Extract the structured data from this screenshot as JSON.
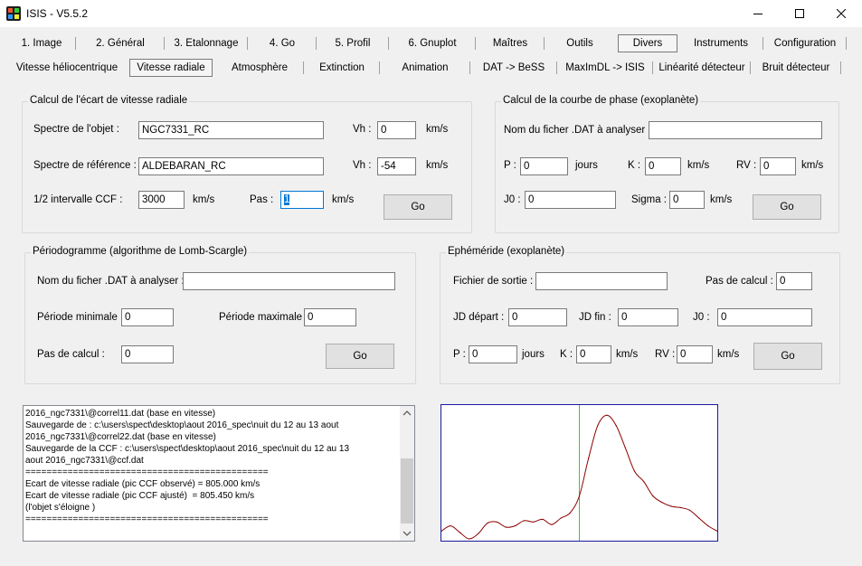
{
  "window": {
    "title": "ISIS - V5.5.2",
    "controls": [
      "minimize-icon",
      "maximize-icon",
      "close-icon"
    ],
    "accent_color": "#0078d7"
  },
  "tabs_row1": [
    {
      "label": "1. Image"
    },
    {
      "label": "2. Général"
    },
    {
      "label": "3. Etalonnage"
    },
    {
      "label": "4. Go"
    },
    {
      "label": "5. Profil"
    },
    {
      "label": "6. Gnuplot"
    },
    {
      "label": "Maîtres"
    },
    {
      "label": "Outils"
    },
    {
      "label": "Divers",
      "selected": true
    },
    {
      "label": "Instruments"
    },
    {
      "label": "Configuration"
    }
  ],
  "tabs_row2": [
    {
      "label": "Vitesse héliocentrique"
    },
    {
      "label": "Vitesse radiale",
      "selected": true
    },
    {
      "label": "Atmosphère"
    },
    {
      "label": "Extinction"
    },
    {
      "label": "Animation"
    },
    {
      "label": "DAT -> BeSS"
    },
    {
      "label": "MaxImDL -> ISIS"
    },
    {
      "label": "Linéarité détecteur"
    },
    {
      "label": "Bruit détecteur"
    }
  ],
  "rv_group": {
    "title": "Calcul de l'écart de vitesse radiale",
    "object_label": "Spectre de l'objet :",
    "object_value": "NGC7331_RC",
    "ref_label": "Spectre de référence :",
    "ref_value": "ALDEBARAN_RC",
    "vh_label": "Vh :",
    "vh_object": "0",
    "vh_ref": "-54",
    "unit": "km/s",
    "ccf_label": "1/2 intervalle  CCF :",
    "ccf_value": "3000",
    "pas_label": "Pas :",
    "pas_value": "1",
    "go": "Go"
  },
  "phase_group": {
    "title": "Calcul de la courbe de phase (exoplanète)",
    "file_label": "Nom du ficher .DAT à analyser :",
    "file_value": "",
    "p_label": "P :",
    "p_value": "0",
    "p_unit": "jours",
    "k_label": "K :",
    "k_value": "0",
    "rv_label": "RV :",
    "rv_value": "0",
    "unit": "km/s",
    "j0_label": "J0 :",
    "j0_value": "0",
    "sigma_label": "Sigma :",
    "sigma_value": "0",
    "go": "Go"
  },
  "periodogram_group": {
    "title": "Périodogramme  (algorithme de Lomb-Scargle)",
    "file_label": "Nom du ficher .DAT à analyser :",
    "file_value": "",
    "pmin_label": "Période minimale :",
    "pmin_value": "0",
    "pmax_label": "Période maximale :",
    "pmax_value": "0",
    "step_label": "Pas de calcul :",
    "step_value": "0",
    "go": "Go"
  },
  "ephem_group": {
    "title": "Ephéméride (exoplanète)",
    "out_label": "Fichier de sortie :",
    "out_value": "",
    "step_label": "Pas de calcul :",
    "step_value": "0",
    "jd_start_label": "JD départ :",
    "jd_start_value": "0",
    "jd_end_label": "JD fin :",
    "jd_end_value": "0",
    "j0_label": "J0 :",
    "j0_value": "0",
    "p_label": "P :",
    "p_value": "0",
    "p_unit": "jours",
    "k_label": "K :",
    "k_value": "0",
    "rv_label": "RV :",
    "rv_value": "0",
    "unit": "km/s",
    "go": "Go"
  },
  "log": {
    "lines": [
      "2016_ngc7331\\@correl11.dat (base en vitesse)",
      "Sauvegarde de : c:\\users\\spect\\desktop\\aout 2016_spec\\nuit du 12 au 13 aout",
      "2016_ngc7331\\@correl22.dat (base en vitesse)",
      "Sauvegarde de la CCF : c:\\users\\spect\\desktop\\aout 2016_spec\\nuit du 12 au 13",
      "aout 2016_ngc7331\\@ccf.dat",
      "==============================================",
      "Ecart de vitesse radiale (pic CCF observé) = 805.000 km/s",
      "Ecart de vitesse radiale (pic CCF ajusté)  = 805.450 km/s",
      "(l'objet s'éloigne )",
      "=============================================="
    ]
  },
  "chart_data": {
    "type": "line",
    "title": "",
    "xlabel": "",
    "ylabel": "",
    "x_range": [
      -3000,
      3000
    ],
    "y_range": [
      0,
      1
    ],
    "grid": false,
    "marker_x": 0,
    "colors": {
      "curve": "#8b0000",
      "marker": "#33cc33",
      "frame": "#1a1aa0"
    },
    "series": [
      {
        "x": [
          -3000,
          -2800,
          -2600,
          -2400,
          -2200,
          -2000,
          -1800,
          -1600,
          -1400,
          -1200,
          -1000,
          -800,
          -600,
          -400,
          -200,
          0,
          200,
          400,
          600,
          800,
          1000,
          1200,
          1400,
          1600,
          1800,
          2000,
          2200,
          2400,
          2600,
          2800,
          3000
        ],
        "values": [
          0.06,
          0.1,
          0.05,
          0.0,
          0.04,
          0.12,
          0.13,
          0.09,
          0.1,
          0.14,
          0.13,
          0.15,
          0.11,
          0.16,
          0.2,
          0.33,
          0.62,
          0.87,
          0.95,
          0.87,
          0.7,
          0.52,
          0.44,
          0.33,
          0.28,
          0.25,
          0.24,
          0.22,
          0.16,
          0.1,
          0.06
        ]
      }
    ]
  }
}
